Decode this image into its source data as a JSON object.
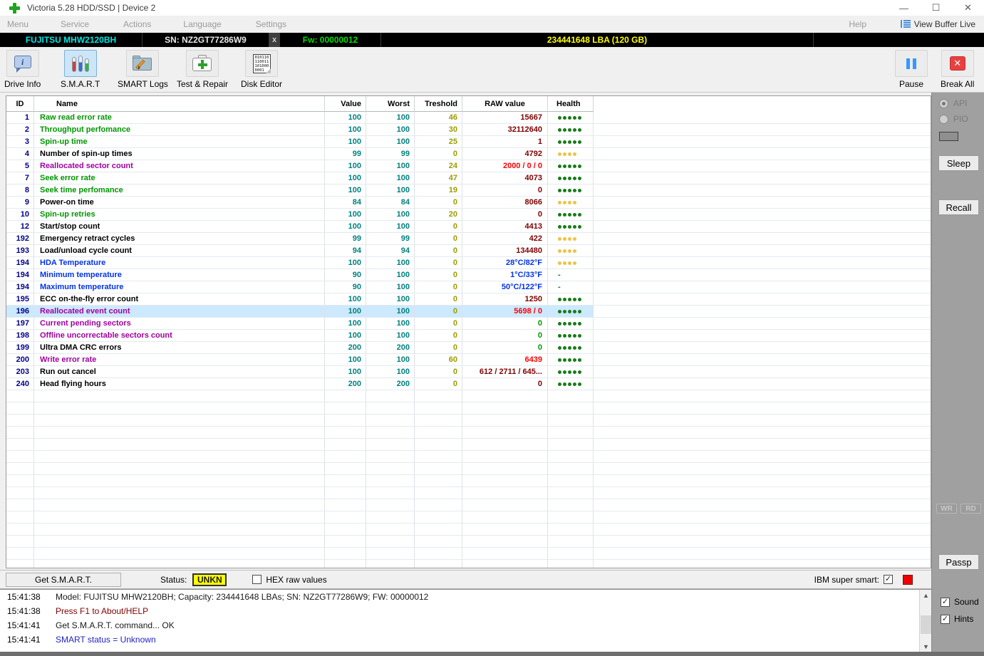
{
  "window": {
    "title": "Victoria 5.28 HDD/SSD | Device 2",
    "controls": {
      "minimize": "—",
      "maximize": "☐",
      "close": "✕"
    }
  },
  "menu": {
    "items": [
      "Menu",
      "Service",
      "Actions",
      "Language",
      "Settings"
    ],
    "help": "Help",
    "view_buffer": "View Buffer Live"
  },
  "device_bar": {
    "model": "FUJITSU MHW2120BH",
    "serial": "SN: NZ2GT77286W9",
    "close_tab": "x",
    "firmware": "Fw: 00000012",
    "capacity": "234441648 LBA (120 GB)"
  },
  "toolbar": {
    "buttons": [
      {
        "label": "Drive Info",
        "icon": "drive-info-icon"
      },
      {
        "label": "S.M.A.R.T",
        "icon": "smart-testtubes-icon",
        "selected": true
      },
      {
        "label": "SMART Logs",
        "icon": "folder-pencil-icon"
      },
      {
        "label": "Test & Repair",
        "icon": "first-aid-icon"
      },
      {
        "label": "Disk Editor",
        "icon": "binary-document-icon"
      }
    ],
    "disk_editor_binary": [
      "010110",
      "110011",
      "101000",
      "0001"
    ],
    "pause": "Pause",
    "break_all": "Break All"
  },
  "table": {
    "columns": [
      "ID",
      "Name",
      "Value",
      "Worst",
      "Treshold",
      "RAW value",
      "Health"
    ],
    "rows": [
      {
        "id": "1",
        "name": "Raw read error rate",
        "name_color": "green",
        "value": "100",
        "worst": "100",
        "treshold": "46",
        "raw": "15667",
        "raw_color": "maroon",
        "health": {
          "dots": 5,
          "color": "green"
        }
      },
      {
        "id": "2",
        "name": "Throughput perfomance",
        "name_color": "green",
        "value": "100",
        "worst": "100",
        "treshold": "30",
        "raw": "32112640",
        "raw_color": "maroon",
        "health": {
          "dots": 5,
          "color": "green"
        }
      },
      {
        "id": "3",
        "name": "Spin-up time",
        "name_color": "green",
        "value": "100",
        "worst": "100",
        "treshold": "25",
        "raw": "1",
        "raw_color": "maroon",
        "health": {
          "dots": 5,
          "color": "green"
        }
      },
      {
        "id": "4",
        "name": "Number of spin-up times",
        "name_color": "black",
        "value": "99",
        "worst": "99",
        "treshold": "0",
        "raw": "4792",
        "raw_color": "maroon",
        "health": {
          "dots": 4,
          "color": "yellow"
        }
      },
      {
        "id": "5",
        "name": "Reallocated sector count",
        "name_color": "purple",
        "value": "100",
        "worst": "100",
        "treshold": "24",
        "raw": "2000 / 0 / 0",
        "raw_color": "red",
        "health": {
          "dots": 5,
          "color": "green"
        }
      },
      {
        "id": "7",
        "name": "Seek error rate",
        "name_color": "green",
        "value": "100",
        "worst": "100",
        "treshold": "47",
        "raw": "4073",
        "raw_color": "maroon",
        "health": {
          "dots": 5,
          "color": "green"
        }
      },
      {
        "id": "8",
        "name": "Seek time perfomance",
        "name_color": "green",
        "value": "100",
        "worst": "100",
        "treshold": "19",
        "raw": "0",
        "raw_color": "maroon",
        "health": {
          "dots": 5,
          "color": "green"
        }
      },
      {
        "id": "9",
        "name": "Power-on time",
        "name_color": "black",
        "value": "84",
        "worst": "84",
        "treshold": "0",
        "raw": "8066",
        "raw_color": "maroon",
        "health": {
          "dots": 4,
          "color": "yellow"
        }
      },
      {
        "id": "10",
        "name": "Spin-up retries",
        "name_color": "green",
        "value": "100",
        "worst": "100",
        "treshold": "20",
        "raw": "0",
        "raw_color": "maroon",
        "health": {
          "dots": 5,
          "color": "green"
        }
      },
      {
        "id": "12",
        "name": "Start/stop count",
        "name_color": "black",
        "value": "100",
        "worst": "100",
        "treshold": "0",
        "raw": "4413",
        "raw_color": "maroon",
        "health": {
          "dots": 5,
          "color": "green"
        }
      },
      {
        "id": "192",
        "name": "Emergency retract cycles",
        "name_color": "black",
        "value": "99",
        "worst": "99",
        "treshold": "0",
        "raw": "422",
        "raw_color": "maroon",
        "health": {
          "dots": 4,
          "color": "yellow"
        }
      },
      {
        "id": "193",
        "name": "Load/unload cycle count",
        "name_color": "black",
        "value": "94",
        "worst": "94",
        "treshold": "0",
        "raw": "134480",
        "raw_color": "maroon",
        "health": {
          "dots": 4,
          "color": "yellow"
        }
      },
      {
        "id": "194",
        "name": "HDA Temperature",
        "name_color": "blue",
        "value": "100",
        "worst": "100",
        "treshold": "0",
        "raw": "28°C/82°F",
        "raw_color": "blue",
        "health": {
          "dots": 4,
          "color": "yellow"
        }
      },
      {
        "id": "194",
        "name": "Minimum temperature",
        "name_color": "blue",
        "value": "90",
        "worst": "100",
        "treshold": "0",
        "raw": "1°C/33°F",
        "raw_color": "blue",
        "health": {
          "text": "-"
        }
      },
      {
        "id": "194",
        "name": "Maximum temperature",
        "name_color": "blue",
        "value": "90",
        "worst": "100",
        "treshold": "0",
        "raw": "50°C/122°F",
        "raw_color": "blue",
        "health": {
          "text": "-"
        }
      },
      {
        "id": "195",
        "name": "ECC on-the-fly error count",
        "name_color": "black",
        "value": "100",
        "worst": "100",
        "treshold": "0",
        "raw": "1250",
        "raw_color": "maroon",
        "health": {
          "dots": 5,
          "color": "green"
        }
      },
      {
        "id": "196",
        "name": "Reallocated event count",
        "name_color": "purple",
        "value": "100",
        "worst": "100",
        "treshold": "0",
        "raw": "5698 / 0",
        "raw_color": "red",
        "health": {
          "dots": 5,
          "color": "green"
        },
        "selected": true
      },
      {
        "id": "197",
        "name": "Current pending sectors",
        "name_color": "purple",
        "value": "100",
        "worst": "100",
        "treshold": "0",
        "raw": "0",
        "raw_color": "green",
        "health": {
          "dots": 5,
          "color": "green"
        }
      },
      {
        "id": "198",
        "name": "Offline uncorrectable sectors count",
        "name_color": "purple",
        "value": "100",
        "worst": "100",
        "treshold": "0",
        "raw": "0",
        "raw_color": "green",
        "health": {
          "dots": 5,
          "color": "green"
        }
      },
      {
        "id": "199",
        "name": "Ultra DMA CRC errors",
        "name_color": "black",
        "value": "200",
        "worst": "200",
        "treshold": "0",
        "raw": "0",
        "raw_color": "green",
        "health": {
          "dots": 5,
          "color": "green"
        }
      },
      {
        "id": "200",
        "name": "Write error rate",
        "name_color": "purple",
        "value": "100",
        "worst": "100",
        "treshold": "60",
        "raw": "6439",
        "raw_color": "red",
        "health": {
          "dots": 5,
          "color": "green"
        }
      },
      {
        "id": "203",
        "name": "Run out cancel",
        "name_color": "black",
        "value": "100",
        "worst": "100",
        "treshold": "0",
        "raw": "612 / 2711 / 645...",
        "raw_color": "maroon",
        "health": {
          "dots": 5,
          "color": "green"
        }
      },
      {
        "id": "240",
        "name": "Head flying hours",
        "name_color": "black",
        "value": "200",
        "worst": "200",
        "treshold": "0",
        "raw": "0",
        "raw_color": "maroon",
        "health": {
          "dots": 5,
          "color": "green"
        }
      }
    ]
  },
  "sidebar": {
    "api": "API",
    "pio": "PIO",
    "sleep": "Sleep",
    "recall": "Recall",
    "wr": "WR",
    "rd": "RD",
    "passp": "Passp",
    "sound": "Sound",
    "hints": "Hints",
    "check_glyph": "✓"
  },
  "statusbar": {
    "get_smart": "Get S.M.A.R.T.",
    "status_label": "Status:",
    "status_value": "UNKN",
    "hex_label": "HEX raw values",
    "ibm_label": "IBM super smart:"
  },
  "log": {
    "entries": [
      {
        "time": "15:41:38",
        "text": "Model: FUJITSU MHW2120BH; Capacity: 234441648 LBAs; SN: NZ2GT77286W9; FW: 00000012",
        "color": "black"
      },
      {
        "time": "15:41:38",
        "text": "Press F1 to About/HELP",
        "color": "maroon"
      },
      {
        "time": "15:41:41",
        "text": "Get S.M.A.R.T. command... OK",
        "color": "black"
      },
      {
        "time": "15:41:41",
        "text": "SMART status = Unknown",
        "color": "blue"
      }
    ]
  },
  "colors": {
    "accent_selection": "#cce9ff",
    "health_green": "#177c17",
    "health_yellow": "#efc344",
    "status_badge_bg": "#ffff00",
    "led_red": "#ee0000",
    "device_model": "#00e5e5",
    "device_fw": "#00dd00",
    "device_capacity": "#ffff00"
  }
}
